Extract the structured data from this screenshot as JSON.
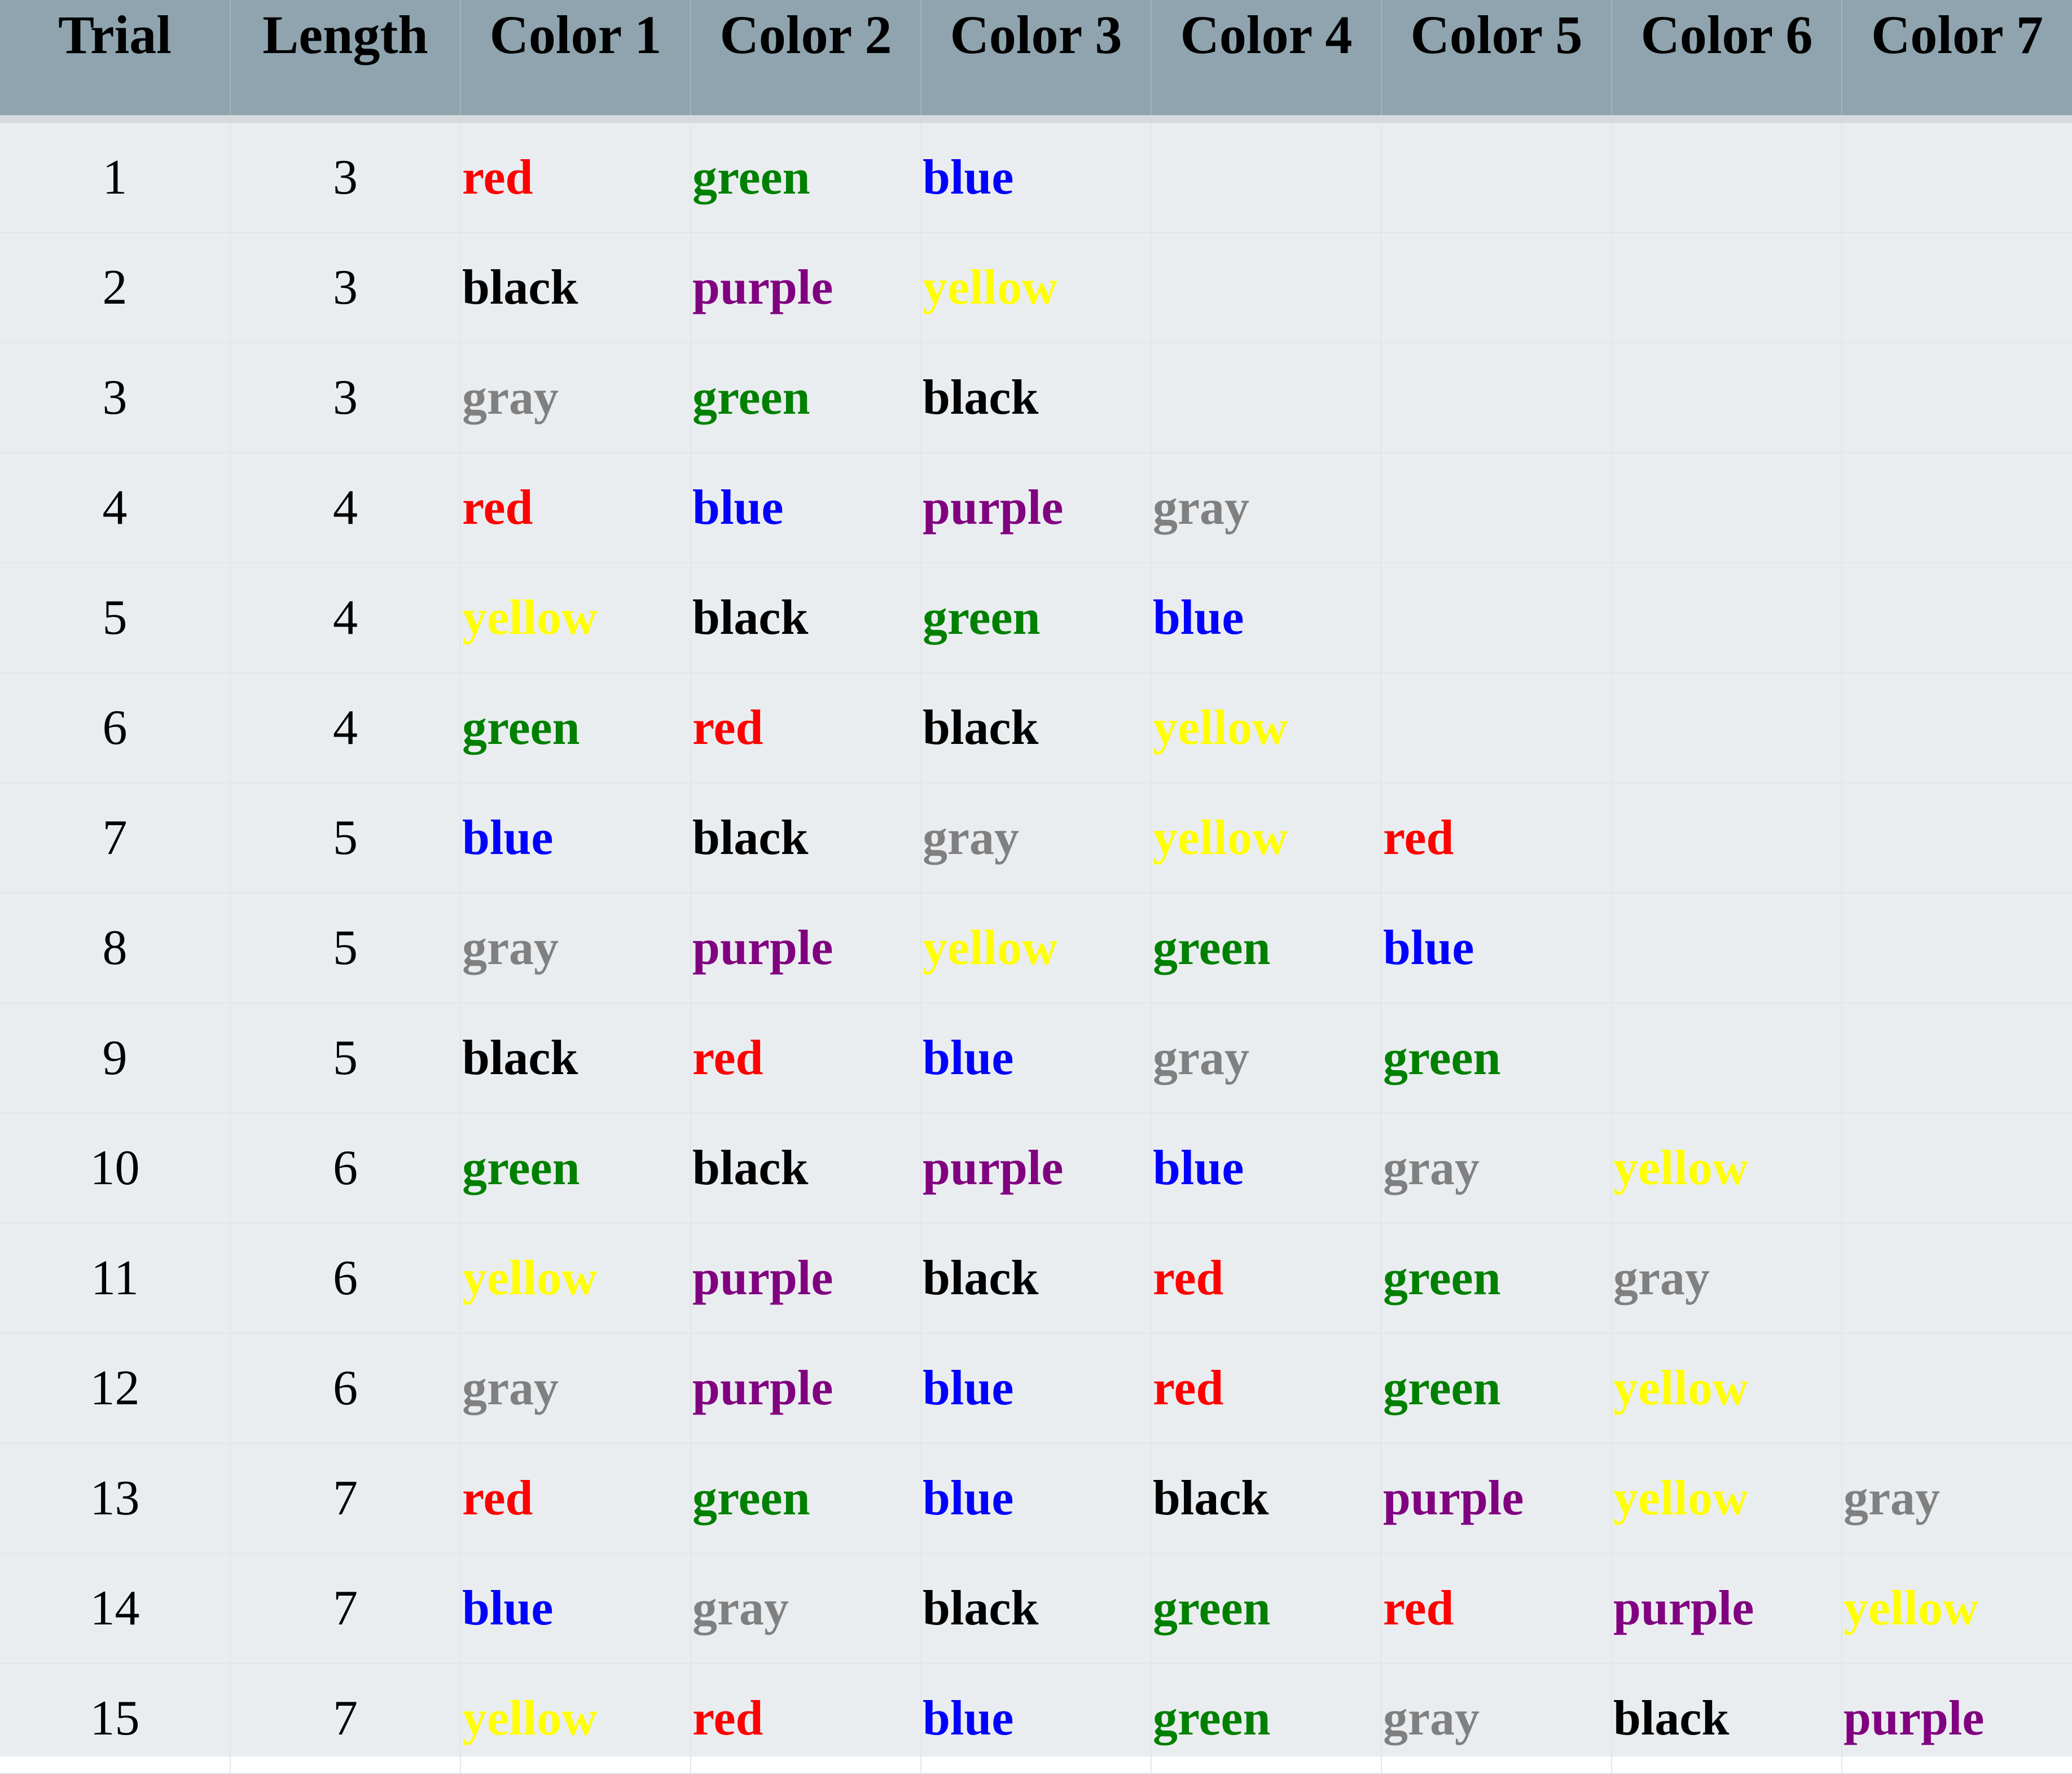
{
  "table": {
    "headers": [
      "Trial",
      "Length",
      "Color 1",
      "Color 2",
      "Color 3",
      "Color 4",
      "Color 5",
      "Color 6",
      "Color 7"
    ],
    "word_colors": {
      "red": "#ff0000",
      "green": "#008000",
      "blue": "#0000ff",
      "black": "#000000",
      "purple": "#800080",
      "yellow": "#ffff00",
      "gray": "#808080"
    },
    "header_background": "#8fa4ae",
    "body_background": "#eaedf0",
    "rows": [
      {
        "trial": "1",
        "length": "3",
        "colors": [
          "red",
          "green",
          "blue"
        ]
      },
      {
        "trial": "2",
        "length": "3",
        "colors": [
          "black",
          "purple",
          "yellow"
        ]
      },
      {
        "trial": "3",
        "length": "3",
        "colors": [
          "gray",
          "green",
          "black"
        ]
      },
      {
        "trial": "4",
        "length": "4",
        "colors": [
          "red",
          "blue",
          "purple",
          "gray"
        ]
      },
      {
        "trial": "5",
        "length": "4",
        "colors": [
          "yellow",
          "black",
          "green",
          "blue"
        ]
      },
      {
        "trial": "6",
        "length": "4",
        "colors": [
          "green",
          "red",
          "black",
          "yellow"
        ]
      },
      {
        "trial": "7",
        "length": "5",
        "colors": [
          "blue",
          "black",
          "gray",
          "yellow",
          "red"
        ]
      },
      {
        "trial": "8",
        "length": "5",
        "colors": [
          "gray",
          "purple",
          "yellow",
          "green",
          "blue"
        ]
      },
      {
        "trial": "9",
        "length": "5",
        "colors": [
          "black",
          "red",
          "blue",
          "gray",
          "green"
        ]
      },
      {
        "trial": "10",
        "length": "6",
        "colors": [
          "green",
          "black",
          "purple",
          "blue",
          "gray",
          "yellow"
        ]
      },
      {
        "trial": "11",
        "length": "6",
        "colors": [
          "yellow",
          "purple",
          "black",
          "red",
          "green",
          "gray"
        ]
      },
      {
        "trial": "12",
        "length": "6",
        "colors": [
          "gray",
          "purple",
          "blue",
          "red",
          "green",
          "yellow"
        ]
      },
      {
        "trial": "13",
        "length": "7",
        "colors": [
          "red",
          "green",
          "blue",
          "black",
          "purple",
          "yellow",
          "gray"
        ]
      },
      {
        "trial": "14",
        "length": "7",
        "colors": [
          "blue",
          "gray",
          "black",
          "green",
          "red",
          "purple",
          "yellow"
        ]
      },
      {
        "trial": "15",
        "length": "7",
        "colors": [
          "yellow",
          "red",
          "blue",
          "green",
          "gray",
          "black",
          "purple"
        ]
      }
    ]
  }
}
